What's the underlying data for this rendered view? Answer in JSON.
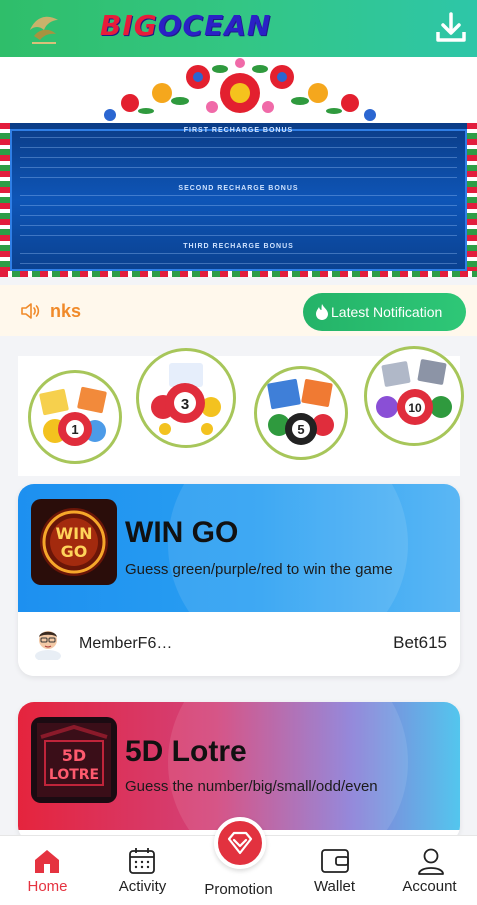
{
  "header": {
    "brand_part1": "BIG",
    "brand_part2": "OCEAN",
    "download_icon": "download-icon"
  },
  "banner": {
    "title_first": "FIRST RECHARGE BONUS",
    "title_second": "SECOND RECHARGE BONUS",
    "title_third": "THIRD RECHARGE BONUS"
  },
  "notice": {
    "text": "nks",
    "latest_label": "Latest Notification"
  },
  "lottery_balls": [
    "1",
    "3",
    "5",
    "10"
  ],
  "games": [
    {
      "title": "WIN GO",
      "icon_text": "WIN GO",
      "description": "Guess green/purple/red to win the game",
      "member": "MemberF6…",
      "bet": "Bet615"
    },
    {
      "title": "5D Lotre",
      "icon_text_1": "5D",
      "icon_text_2": "LOTRE",
      "description": "Guess the number/big/small/odd/even"
    }
  ],
  "nav": {
    "items": [
      {
        "label": "Home",
        "icon": "home-icon",
        "active": true
      },
      {
        "label": "Activity",
        "icon": "calendar-icon",
        "active": false
      },
      {
        "label": "Promotion",
        "icon": "diamond-icon",
        "active": false
      },
      {
        "label": "Wallet",
        "icon": "wallet-icon",
        "active": false
      },
      {
        "label": "Account",
        "icon": "user-icon",
        "active": false
      }
    ]
  },
  "colors": {
    "header_green": "#33c684",
    "active_red": "#e53340",
    "notice_orange": "#f08a2a"
  }
}
